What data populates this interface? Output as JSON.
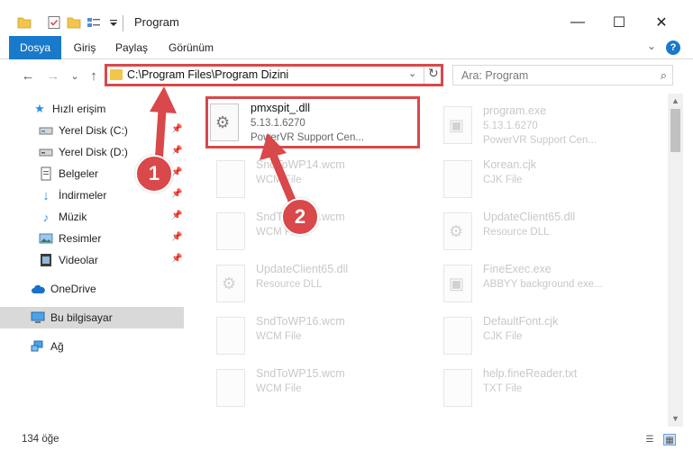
{
  "window": {
    "title": "Program",
    "minimize_glyph": "—",
    "maximize_glyph": "☐",
    "close_glyph": "✕"
  },
  "ribbon": {
    "tabs": [
      "Dosya",
      "Giriş",
      "Paylaş",
      "Görünüm"
    ],
    "expand_glyph": "⌄",
    "help_glyph": "?"
  },
  "address": {
    "path": "C:\\Program Files\\Program Dizini",
    "chevron_glyph": "⌄",
    "refresh_glyph": "↻"
  },
  "nav": {
    "back_glyph": "←",
    "forward_glyph": "→",
    "recent_glyph": "⌄",
    "up_glyph": "↑"
  },
  "search": {
    "placeholder": "Ara: Program",
    "icon_glyph": "⌕"
  },
  "sidebar": {
    "quick_access": "Hızlı erişim",
    "items": [
      {
        "label": "Yerel Disk (C:)",
        "icon": "drive-icon"
      },
      {
        "label": "Yerel Disk (D:)",
        "icon": "drive-icon"
      },
      {
        "label": "Belgeler",
        "icon": "documents-icon"
      },
      {
        "label": "İndirmeler",
        "icon": "downloads-icon"
      },
      {
        "label": "Müzik",
        "icon": "music-icon"
      },
      {
        "label": "Resimler",
        "icon": "pictures-icon"
      },
      {
        "label": "Videolar",
        "icon": "videos-icon"
      }
    ],
    "onedrive": "OneDrive",
    "this_pc": "Bu bilgisayar",
    "network": "Ağ"
  },
  "files": [
    {
      "name": "pmxspit_.dll",
      "line2": "5.13.1.6270",
      "line3": "PowerVR Support Cen...",
      "highlight": true
    },
    {
      "name": "program.exe",
      "line2": "5.13.1.6270",
      "line3": "PowerVR Support Cen...",
      "type": "exe"
    },
    {
      "name": "SndToWP14.wcm",
      "line2": "WCM File",
      "line3": ""
    },
    {
      "name": "Korean.cjk",
      "line2": "CJK File",
      "line3": ""
    },
    {
      "name": "SndToWP13.wcm",
      "line2": "WCM File",
      "line3": ""
    },
    {
      "name": "UpdateClient65.dll",
      "line2": "Resource DLL",
      "line3": ""
    },
    {
      "name": "UpdateClient65.dll",
      "line2": "Resource DLL",
      "line3": ""
    },
    {
      "name": "FineExec.exe",
      "line2": "ABBYY background exe...",
      "line3": "",
      "type": "exe"
    },
    {
      "name": "SndToWP16.wcm",
      "line2": "WCM File",
      "line3": ""
    },
    {
      "name": "DefaultFont.cjk",
      "line2": "CJK File",
      "line3": ""
    },
    {
      "name": "SndToWP15.wcm",
      "line2": "WCM File",
      "line3": ""
    },
    {
      "name": "help.fineReader.txt",
      "line2": "TXT File",
      "line3": ""
    }
  ],
  "status": {
    "count": "134 öğe"
  },
  "annotations": {
    "step1": "1",
    "step2": "2",
    "color": "#d9484a"
  }
}
